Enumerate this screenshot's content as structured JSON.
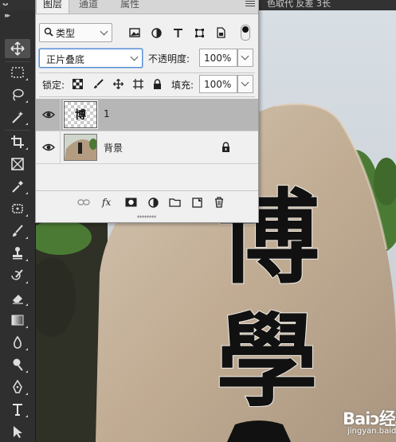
{
  "top_bar": {
    "app_glyph": "ᴗ",
    "right_text": "色取代 反差 3长"
  },
  "toolbar": {
    "collapse_arrows": "▸▸",
    "tools": [
      {
        "name": "move-tool",
        "icon": "move-icon",
        "active": true
      },
      {
        "name": "marquee-tool",
        "icon": "marquee-icon"
      },
      {
        "name": "lasso-tool",
        "icon": "lasso-icon"
      },
      {
        "name": "magic-wand-tool",
        "icon": "magic-wand-icon"
      },
      {
        "name": "crop-tool",
        "icon": "crop-icon"
      },
      {
        "name": "frame-tool",
        "icon": "frame-icon"
      },
      {
        "name": "eyedropper-tool",
        "icon": "eyedropper-icon"
      },
      {
        "name": "healing-tool",
        "icon": "healing-icon"
      },
      {
        "name": "brush-tool",
        "icon": "brush-icon"
      },
      {
        "name": "stamp-tool",
        "icon": "stamp-icon"
      },
      {
        "name": "history-brush-tool",
        "icon": "history-brush-icon"
      },
      {
        "name": "eraser-tool",
        "icon": "eraser-icon"
      },
      {
        "name": "gradient-tool",
        "icon": "gradient-icon"
      },
      {
        "name": "blur-tool",
        "icon": "blur-icon"
      },
      {
        "name": "dodge-tool",
        "icon": "dodge-icon"
      },
      {
        "name": "pen-tool",
        "icon": "pen-icon"
      },
      {
        "name": "type-tool",
        "icon": "type-icon"
      },
      {
        "name": "path-select-tool",
        "icon": "path-select-icon"
      }
    ]
  },
  "panel": {
    "tabs": [
      "图层",
      "通道",
      "属性"
    ],
    "active_tab": 0,
    "filter": {
      "kind_label": "类型"
    },
    "blend_mode": "正片叠底",
    "opacity_label": "不透明度:",
    "opacity_value": "100%",
    "lock_label": "锁定:",
    "fill_label": "填充:",
    "fill_value": "100%",
    "layers": [
      {
        "name": "1",
        "selected": true,
        "visible": true,
        "locked": false,
        "thumb_text": "博"
      },
      {
        "name": "背景",
        "selected": false,
        "visible": true,
        "locked": true
      }
    ]
  },
  "canvas": {
    "calligraphy": [
      "博",
      "學"
    ],
    "colors": {
      "sky": "#cfd8e0",
      "stone": "#c3ae95",
      "ink": "#111111",
      "foliage": "#4f7a3c"
    }
  },
  "watermark": {
    "logo": "Baiↄ经验",
    "url": "jingyan.baidu.com"
  }
}
